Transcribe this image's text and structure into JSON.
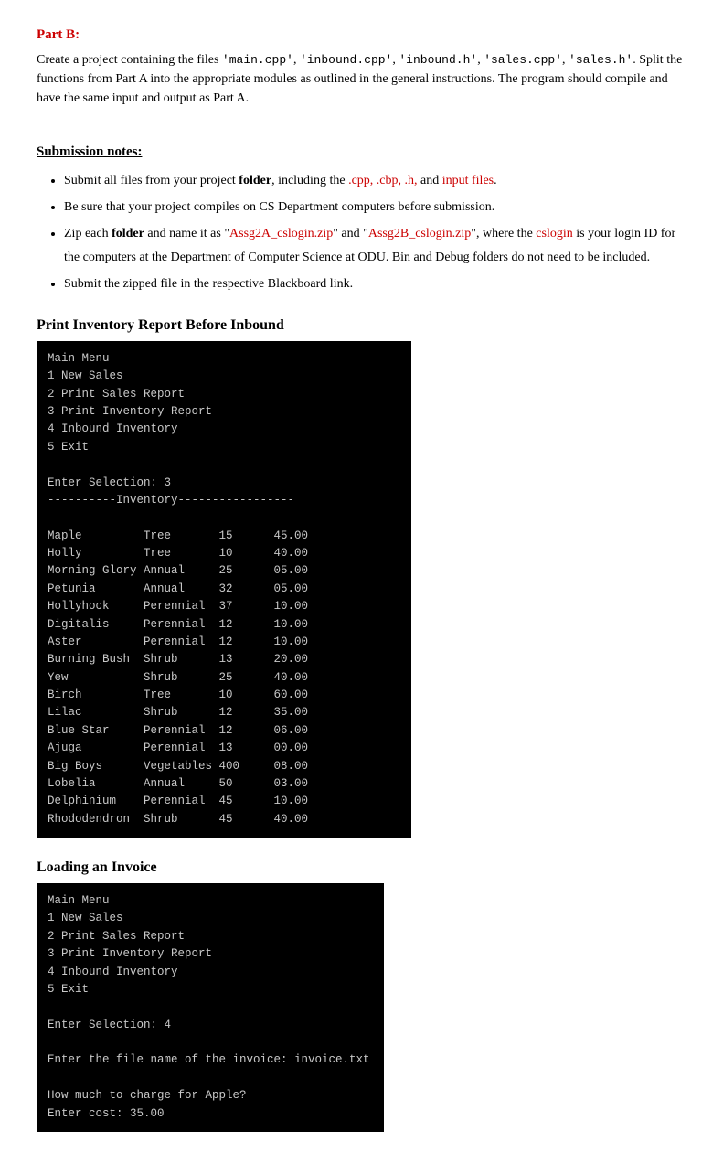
{
  "partB": {
    "label": "Part B:",
    "intro": "Create a project containing the files ",
    "files": [
      "'main.cpp'",
      "'inbound.cpp'",
      "'inbound.h'",
      "'sales.cpp'",
      "'sales.h'"
    ],
    "introRest": ". Split the functions from Part A into the appropriate modules as outlined in the general instructions. The program should compile and have the same input and output as Part A.",
    "submission": {
      "title": "Submission notes:",
      "bullets": [
        {
          "text_before": "Submit all files from your project ",
          "bold": "folder",
          "text_middle": ", including the ",
          "red": ".cpp, .cbp, .h,",
          "text_after": " and ",
          "red2": "input files",
          "text_end": "."
        },
        {
          "text": "Be sure that your project compiles on CS Department computers before submission."
        },
        {
          "text_before": "Zip each ",
          "bold": "folder",
          "text_middle": " and name it as \"",
          "red": "Assg2A_cslogin.zip",
          "text_middle2": "\" and \"",
          "red2": "Assg2B_cslogin.zip",
          "text_middle3": "\", where the ",
          "red3": "cslogin",
          "text_after": " is your login ID for the computers at the Department of Computer Science at ODU. Bin and Debug folders do not need to be included."
        },
        {
          "text": "Submit the zipped file in the respective Blackboard link."
        }
      ]
    }
  },
  "printInventory": {
    "title": "Print Inventory Report Before Inbound",
    "terminal": "Main Menu\n1 New Sales\n2 Print Sales Report\n3 Print Inventory Report\n4 Inbound Inventory\n5 Exit\n\nEnter Selection: 3\n----------Inventory-----------------\n\nMaple         Tree       15      45.00\nHolly         Tree       10      40.00\nMorning Glory Annual     25      05.00\nPetunia       Annual     32      05.00\nHollyhock     Perennial  37      10.00\nDigitalis     Perennial  12      10.00\nAster         Perennial  12      10.00\nBurning Bush  Shrub      13      20.00\nYew           Shrub      25      40.00\nBirch         Tree       10      60.00\nLilac         Shrub      12      35.00\nBlue Star     Perennial  12      06.00\nAjuga         Perennial  13      00.00\nBig Boys      Vegetables 400     08.00\nLobelia       Annual     50      03.00\nDelphinium    Perennial  45      10.00\nRhododendron  Shrub      45      40.00"
  },
  "loadingInvoice": {
    "title": "Loading an Invoice",
    "terminal": "Main Menu\n1 New Sales\n2 Print Sales Report\n3 Print Inventory Report\n4 Inbound Inventory\n5 Exit\n\nEnter Selection: 4\n\nEnter the file name of the invoice: invoice.txt\n\nHow much to charge for Apple?\nEnter cost: 35.00"
  }
}
